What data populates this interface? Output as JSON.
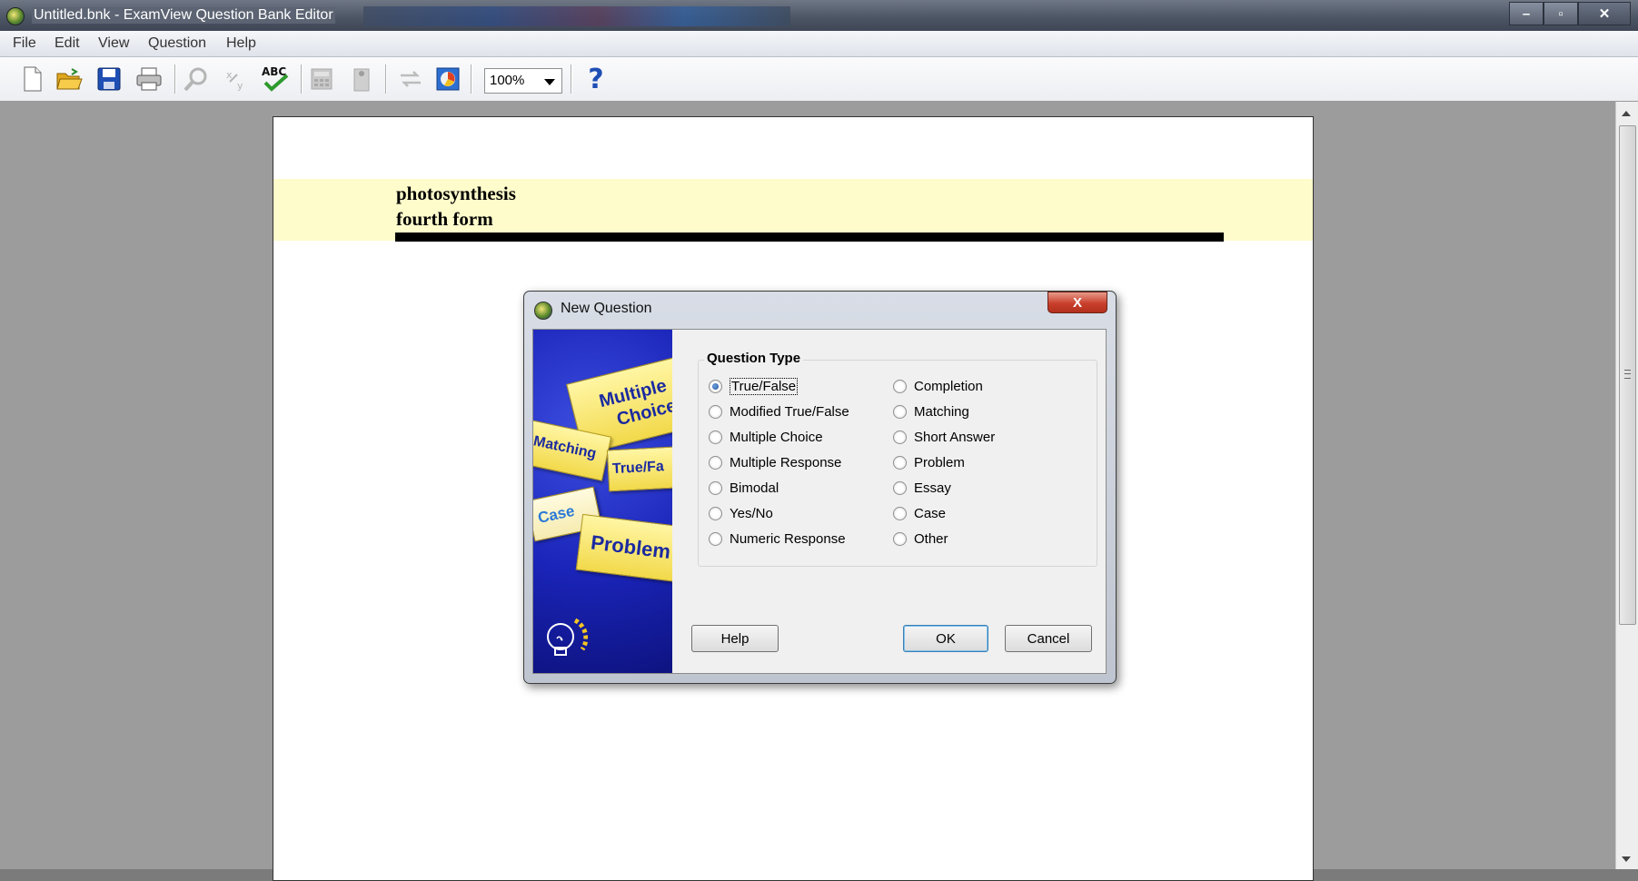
{
  "window": {
    "title": "Untitled.bnk - ExamView Question Bank Editor",
    "minimize": "–",
    "restore": "▫",
    "close": "✕"
  },
  "menu": {
    "items": [
      "File",
      "Edit",
      "View",
      "Question",
      "Help"
    ]
  },
  "toolbar": {
    "zoom_value": "100%",
    "spell_label": "ABC",
    "help_glyph": "?"
  },
  "document": {
    "title_line1": "photosynthesis",
    "title_line2": "fourth form",
    "header_band_color": "#fefccb"
  },
  "dialog": {
    "title": "New Question",
    "close_glyph": "X",
    "group_title": "Question Type",
    "art_labels": [
      "Multiple",
      "Choice",
      "Matching",
      "True/Fa",
      "Case",
      "Problem"
    ],
    "options_left": [
      "True/False",
      "Modified True/False",
      "Multiple Choice",
      "Multiple Response",
      "Bimodal",
      "Yes/No",
      "Numeric Response"
    ],
    "options_right": [
      "Completion",
      "Matching",
      "Short Answer",
      "Problem",
      "Essay",
      "Case",
      "Other"
    ],
    "selected": "True/False",
    "help_button": "Help",
    "ok_button": "OK",
    "cancel_button": "Cancel"
  }
}
